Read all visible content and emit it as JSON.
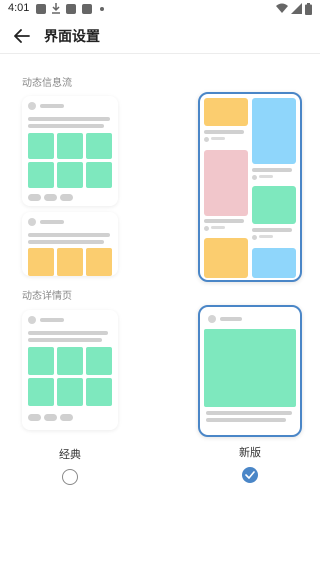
{
  "status_bar": {
    "time": "4:01",
    "left_icons": [
      "image-icon",
      "download-icon",
      "app-icon",
      "app-icon",
      "dot-icon"
    ],
    "right_icons": [
      "wifi-icon",
      "signal-icon",
      "battery-icon"
    ]
  },
  "header": {
    "title": "界面设置",
    "back_icon": "arrow-left-icon"
  },
  "sections": {
    "feed": {
      "label": "动态信息流"
    },
    "detail": {
      "label": "动态详情页"
    }
  },
  "options": {
    "classic": {
      "label": "经典",
      "selected": false
    },
    "new": {
      "label": "新版",
      "selected": true
    }
  },
  "colors": {
    "accent": "#4a86c7",
    "green": "#7ee8be",
    "yellow": "#fbcd6f",
    "blue": "#8fd6fb",
    "pink": "#f1c6cb"
  }
}
